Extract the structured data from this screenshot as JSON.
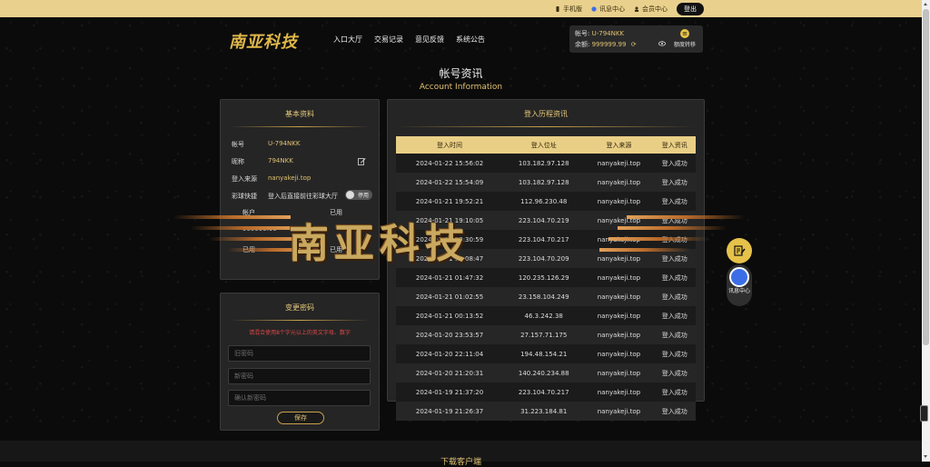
{
  "topbar": {
    "mobile": "手机版",
    "messages": "讯息中心",
    "member": "会员中心",
    "logout": "登出"
  },
  "header": {
    "logo": "南亚科技",
    "nav": [
      "入口大厅",
      "交易记录",
      "意见反馈",
      "系统公告"
    ]
  },
  "account_box": {
    "account_label": "帐号:",
    "account_value": "U-794NKK",
    "balance_label": "余额:",
    "balance_value": "999999.99",
    "transfer_label": "额度转移"
  },
  "page": {
    "title": "帐号资讯",
    "subtitle": "Account Information"
  },
  "basic_info": {
    "title": "基本资料",
    "rows": [
      {
        "label": "帐号",
        "value": "U-794NKK"
      },
      {
        "label": "昵称",
        "value": "794NKK"
      },
      {
        "label": "登入来源",
        "value": "nanyakeji.top"
      },
      {
        "label": "彩球快捷",
        "value": "登入后直接前往彩球大厅"
      }
    ],
    "toggle_label": "停用",
    "sub_header_1": "帐户",
    "sub_header_2": "已用",
    "sub_balance": "999999.99",
    "sub_action_1": "已用",
    "sub_action_2": "已用"
  },
  "password": {
    "title": "变更密码",
    "warning": "请混合使用8个字元以上的英文字母、数字",
    "old_placeholder": "旧密码",
    "new_placeholder": "新密码",
    "confirm_placeholder": "确认新密码",
    "save": "保存"
  },
  "history": {
    "title": "登入历程资讯",
    "columns": [
      "登入时间",
      "登入位址",
      "登入来源",
      "登入资讯"
    ],
    "rows": [
      [
        "2024-01-22 15:56:02",
        "103.182.97.128",
        "nanyakeji.top",
        "登入成功"
      ],
      [
        "2024-01-22 15:54:09",
        "103.182.97.128",
        "nanyakeji.top",
        "登入成功"
      ],
      [
        "2024-01-21 19:52:21",
        "112.96.230.48",
        "nanyakeji.top",
        "登入成功"
      ],
      [
        "2024-01-21 19:10:05",
        "223.104.70.219",
        "nanyakeji.top",
        "登入成功"
      ],
      [
        "2024-01-21 18:30:59",
        "223.104.70.217",
        "nanyakeji.top",
        "登入成功"
      ],
      [
        "2024-01-21 16:08:47",
        "223.104.70.209",
        "nanyakeji.top",
        "登入成功"
      ],
      [
        "2024-01-21 01:47:32",
        "120.235.126.29",
        "nanyakeji.top",
        "登入成功"
      ],
      [
        "2024-01-21 01:02:55",
        "23.158.104.249",
        "nanyakeji.top",
        "登入成功"
      ],
      [
        "2024-01-21 00:13:52",
        "46.3.242.38",
        "nanyakeji.top",
        "登入成功"
      ],
      [
        "2024-01-20 23:53:57",
        "27.157.71.175",
        "nanyakeji.top",
        "登入成功"
      ],
      [
        "2024-01-20 22:11:04",
        "194.48.154.21",
        "nanyakeji.top",
        "登入成功"
      ],
      [
        "2024-01-20 21:20:31",
        "140.240.234.88",
        "nanyakeji.top",
        "登入成功"
      ],
      [
        "2024-01-19 21:37:20",
        "223.104.70.217",
        "nanyakeji.top",
        "登入成功"
      ],
      [
        "2024-01-19 21:26:37",
        "31.223.184.81",
        "nanyakeji.top",
        "登入成功"
      ]
    ]
  },
  "overlay_banner": "南亚科技",
  "float": {
    "messages_label": "讯息中心"
  },
  "footer": {
    "text": "下载客户端"
  },
  "colors": {
    "gold": "#e9d08d",
    "accent": "#e0c070",
    "warning": "#e04848"
  }
}
